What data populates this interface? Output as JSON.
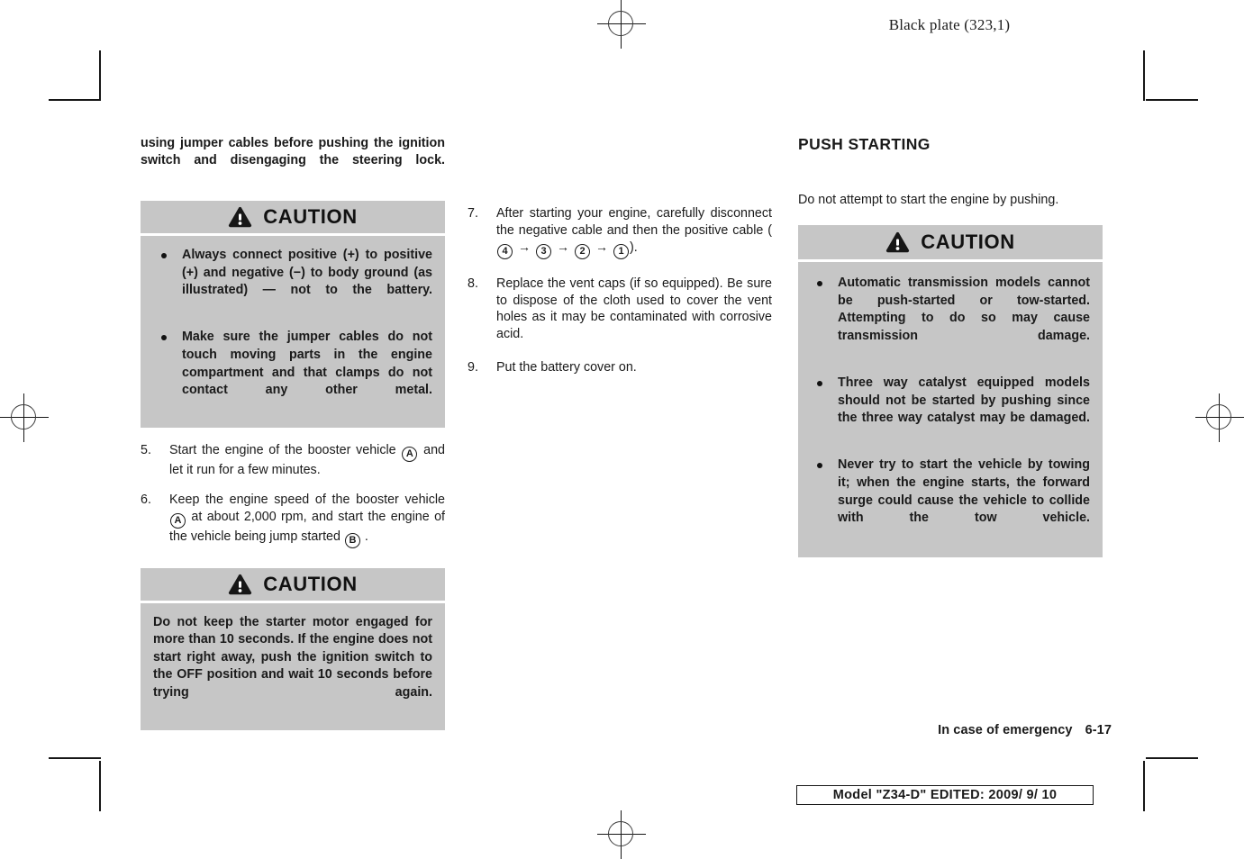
{
  "print_marks": {
    "header_note": "Black plate (323,1)"
  },
  "columns": {
    "left": {
      "continuation_paragraph": "using jumper cables before pushing the ignition switch and disengaging the steering lock.",
      "caution_1": {
        "title": "CAUTION",
        "icon": "warning-triangle-icon",
        "bullets": [
          "Always connect positive (+) to positive (+) and negative (−) to body ground (as illustrated) — not to the battery.",
          "Make sure the jumper cables do not touch moving parts in the engine compartment and that clamps do not contact any other metal."
        ]
      },
      "steps": [
        {
          "number": "5.",
          "text_parts": [
            "Start the engine of the booster vehicle ",
            "A",
            " and let it run for a few minutes."
          ]
        },
        {
          "number": "6.",
          "text_parts": [
            "Keep the engine speed of the booster vehicle ",
            "A",
            " at about 2,000 rpm, and start the engine of the vehicle being jump started ",
            "B",
            " ."
          ]
        }
      ],
      "caution_2": {
        "title": "CAUTION",
        "icon": "warning-triangle-icon",
        "paragraph": "Do not keep the starter motor engaged for more than 10 seconds. If the engine does not start right away, push the ignition switch to the OFF position and wait 10 seconds before trying again."
      }
    },
    "middle": {
      "steps": [
        {
          "number": "7.",
          "lead": "After starting your engine, carefully disconnect the negative cable and then the positive cable (",
          "sequence": [
            "4",
            "3",
            "2",
            "1"
          ],
          "arrow": "→",
          "tail": ")."
        },
        {
          "number": "8.",
          "text": "Replace the vent caps (if so equipped). Be sure to dispose of the cloth used to cover the vent holes as it may be contaminated with corrosive acid."
        },
        {
          "number": "9.",
          "text": "Put the battery cover on."
        }
      ]
    },
    "right": {
      "section_title": "PUSH STARTING",
      "intro": "Do not attempt to start the engine by pushing.",
      "caution_3": {
        "title": "CAUTION",
        "icon": "warning-triangle-icon",
        "bullets": [
          "Automatic transmission models cannot be push-started or tow-started. Attempting to do so may cause transmission damage.",
          "Three way catalyst equipped models should not be started by pushing since the three way catalyst may be damaged.",
          "Never try to start the vehicle by towing it; when the engine starts, the forward surge could cause the vehicle to collide with the tow vehicle."
        ]
      }
    }
  },
  "footer": {
    "chapter_title": "In case of emergency",
    "page_number": "6-17",
    "model_stamp": "Model \"Z34-D\"  EDITED:  2009/ 9/ 10"
  },
  "colors": {
    "caution_gray": "#c6c6c6",
    "text": "#1a1a1a",
    "mark": "#171717"
  }
}
